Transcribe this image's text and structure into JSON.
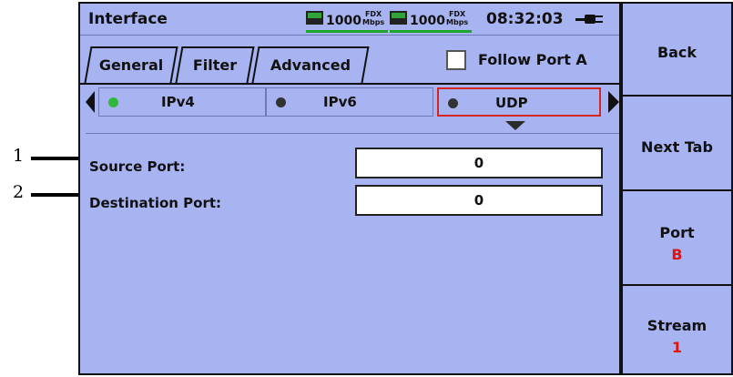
{
  "callouts": [
    {
      "label": "1"
    },
    {
      "label": "2"
    }
  ],
  "header": {
    "title": "Interface",
    "port_a_speed": "1000",
    "port_a_fdx": "FDX",
    "port_a_unit": "Mbps",
    "port_b_speed": "1000",
    "port_b_fdx": "FDX",
    "port_b_unit": "Mbps",
    "time": "08:32:03",
    "power_icon": "ac-plug-icon"
  },
  "tabs": [
    {
      "label": "General",
      "active": true
    },
    {
      "label": "Filter",
      "active": false
    },
    {
      "label": "Advanced",
      "active": false
    }
  ],
  "follow_port": {
    "label": "Follow Port A",
    "checked": false
  },
  "protocols": [
    {
      "label": "IPv4",
      "status_color": "#2fb83a",
      "selected": false
    },
    {
      "label": "IPv6",
      "status_color": "#333333",
      "selected": false
    },
    {
      "label": "UDP",
      "status_color": "#333333",
      "selected": true
    }
  ],
  "fields": [
    {
      "label": "Source Port:",
      "value": "0"
    },
    {
      "label": "Destination Port:",
      "value": "0"
    }
  ],
  "side_buttons": [
    {
      "label": "Back",
      "value": ""
    },
    {
      "label": "Next Tab",
      "value": ""
    },
    {
      "label": "Port",
      "value": "B"
    },
    {
      "label": "Stream",
      "value": "1"
    }
  ],
  "colors": {
    "panel_bg": "#a8b4f2",
    "accent_red": "#e3120b",
    "link_green": "#1ea62a"
  }
}
